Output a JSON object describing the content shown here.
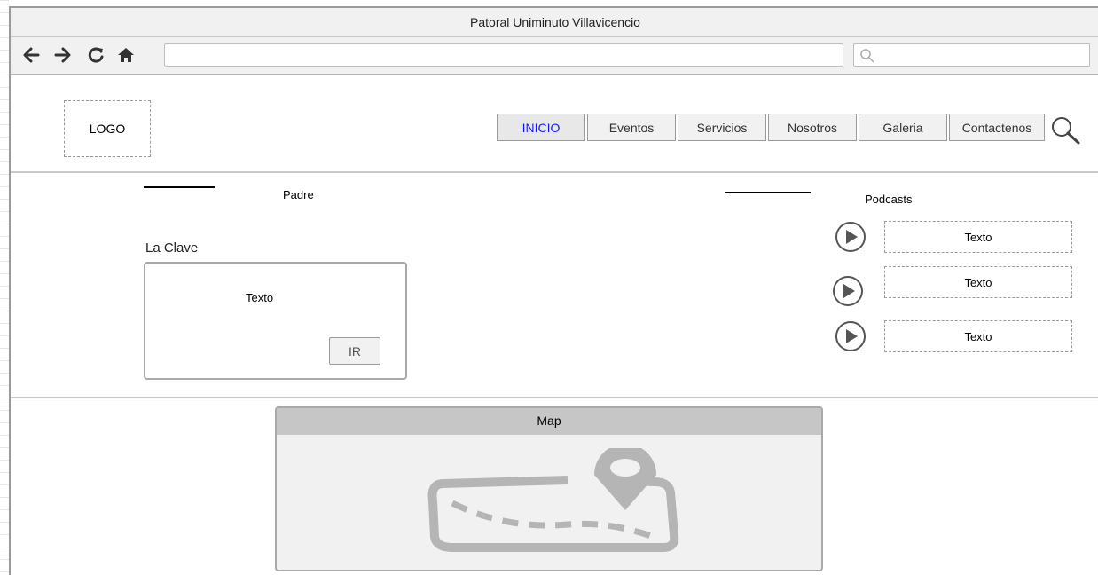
{
  "window": {
    "title": "Patoral Uniminuto Villavicencio"
  },
  "browser": {
    "url_value": "",
    "search_value": "",
    "icons": [
      "back-arrow-icon",
      "forward-arrow-icon",
      "reload-icon",
      "home-icon",
      "search-icon"
    ]
  },
  "header": {
    "logo_text": "LOGO",
    "menu": [
      {
        "label": "INICIO",
        "active": true
      },
      {
        "label": "Eventos"
      },
      {
        "label": "Servicios"
      },
      {
        "label": "Nosotros"
      },
      {
        "label": "Galeria"
      },
      {
        "label": "Contactenos"
      }
    ]
  },
  "content": {
    "left_heading": "Padre",
    "clave_label": "La Clave",
    "clave_text": "Texto",
    "ir_button": "IR",
    "podcasts_heading": "Podcasts",
    "podcasts": [
      {
        "text": "Texto"
      },
      {
        "text": "Texto"
      },
      {
        "text": "Texto"
      }
    ]
  },
  "map": {
    "title": "Map"
  },
  "colors": {
    "active_link": "#1a1aff",
    "border": "#9a9a9a",
    "panel_bg": "#f1f1f1",
    "map_header": "#c6c6c6"
  }
}
